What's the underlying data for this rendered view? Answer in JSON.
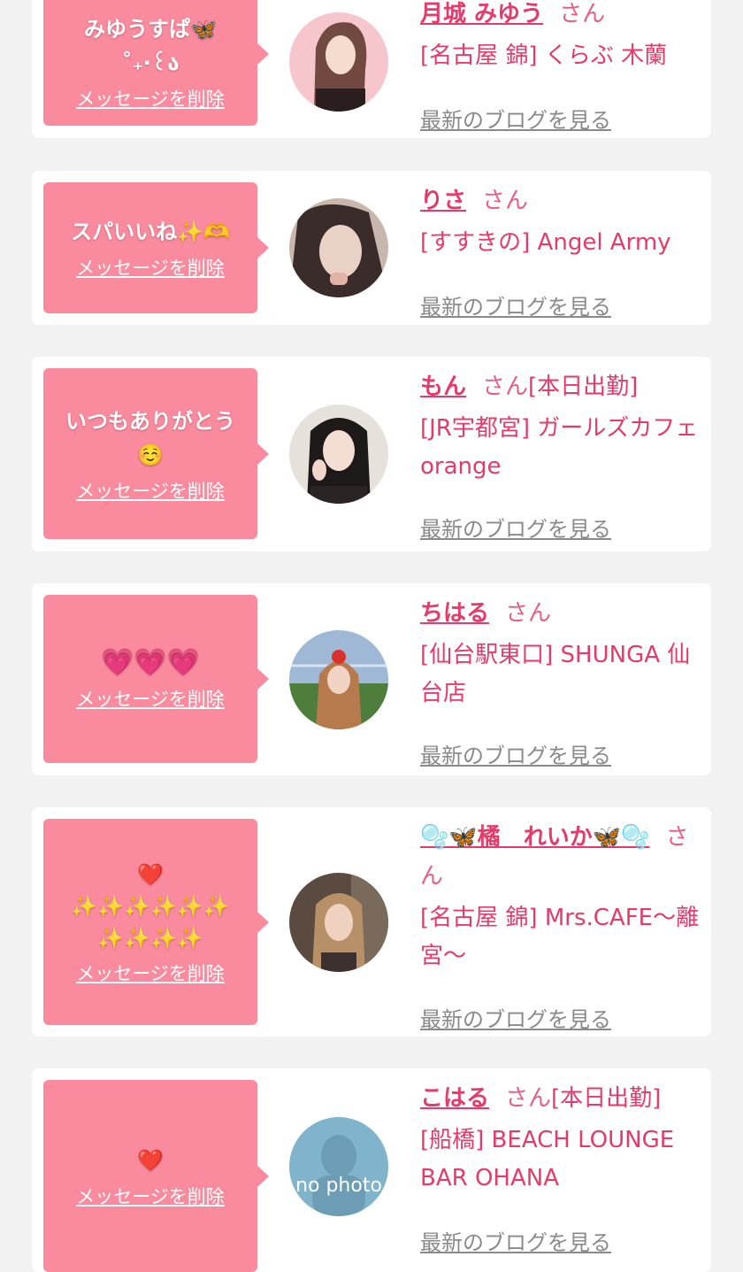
{
  "cards": [
    {
      "message": "みゆうすぱ🦋\n˚₊‧꒰ა",
      "delete_label": "メッセージを削除",
      "name": "月城 みゆう",
      "san": "さん",
      "status": "",
      "shop": "[名古屋 錦] くらぶ 木蘭",
      "blog_link": "最新のブログを見る"
    },
    {
      "message": "スパいいね✨🫶",
      "delete_label": "メッセージを削除",
      "name": "りさ",
      "san": "さん",
      "status": "",
      "shop": "[すすきの] Angel Army",
      "blog_link": "最新のブログを見る"
    },
    {
      "message": "いつもありがとう\n☺️",
      "delete_label": "メッセージを削除",
      "name": "もん",
      "san": "さん",
      "status": "[本日出勤]",
      "shop": "[JR宇都宮] ガールズカフェ orange",
      "blog_link": "最新のブログを見る"
    },
    {
      "message": "💗💗💗",
      "delete_label": "メッセージを削除",
      "name": "ちはる",
      "san": "さん",
      "status": "",
      "shop": "[仙台駅東口] SHUNGA 仙台店",
      "blog_link": "最新のブログを見る"
    },
    {
      "message": "❤️\n✨✨✨✨✨✨\n✨✨✨✨",
      "delete_label": "メッセージを削除",
      "name": "🫧🦋橘　れいか🦋🫧",
      "san": "さん",
      "status": "",
      "shop": "[名古屋 錦] Mrs.CAFE〜離宮〜",
      "blog_link": "最新のブログを見る"
    },
    {
      "message": "❤️",
      "delete_label": "メッセージを削除",
      "name": "こはる",
      "san": "さん",
      "status": "[本日出勤]",
      "shop": "[船橋] BEACH LOUNGE BAR OHANA",
      "blog_link": "最新のブログを見る",
      "avatar_text": "no photo"
    }
  ]
}
